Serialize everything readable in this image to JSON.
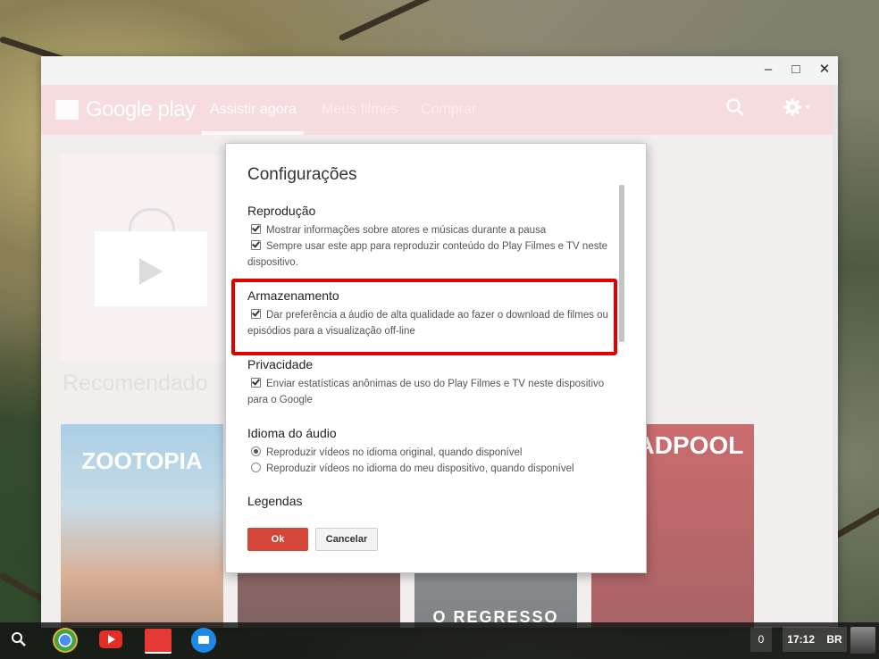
{
  "window": {
    "controls": {
      "minimize": "–",
      "maximize": "□",
      "close": "✕"
    }
  },
  "appbar": {
    "logo": "Google play",
    "tabs": [
      "Assistir agora",
      "Meus filmes",
      "Comprar"
    ],
    "search_icon": "search-icon",
    "settings_icon": "gear-icon"
  },
  "background": {
    "section_title": "Recomendado",
    "posters": [
      "ZOOTOPIA",
      "",
      "O REGRESSO",
      "DEADPOOL"
    ]
  },
  "dialog": {
    "title": "Configurações",
    "sections": {
      "reproducao": {
        "heading": "Reprodução",
        "option1": "Mostrar informações sobre atores e músicas durante a pausa",
        "option2": "Sempre usar este app para reproduzir conteúdo do Play Filmes e TV neste dispositivo."
      },
      "armazenamento": {
        "heading": "Armazenamento",
        "option1": "Dar preferência a áudio de alta qualidade ao fazer o download de filmes ou episódios para a visualização off-line"
      },
      "privacidade": {
        "heading": "Privacidade",
        "option1": "Enviar estatísticas anônimas de uso do Play Filmes e TV neste dispositivo para o Google"
      },
      "idioma": {
        "heading": "Idioma do áudio",
        "option1": "Reproduzir vídeos no idioma original, quando disponível",
        "option2": "Reproduzir vídeos no idioma do meu dispositivo, quando disponível",
        "selected": 1
      },
      "legendas": {
        "heading": "Legendas"
      }
    },
    "ok_label": "Ok",
    "cancel_label": "Cancelar"
  },
  "shelf": {
    "notifications": "0",
    "time": "17:12",
    "locale": "BR"
  },
  "colors": {
    "appbar": "#f2c9c9",
    "ok_button": "#d3473a",
    "highlight": "#e00000"
  }
}
